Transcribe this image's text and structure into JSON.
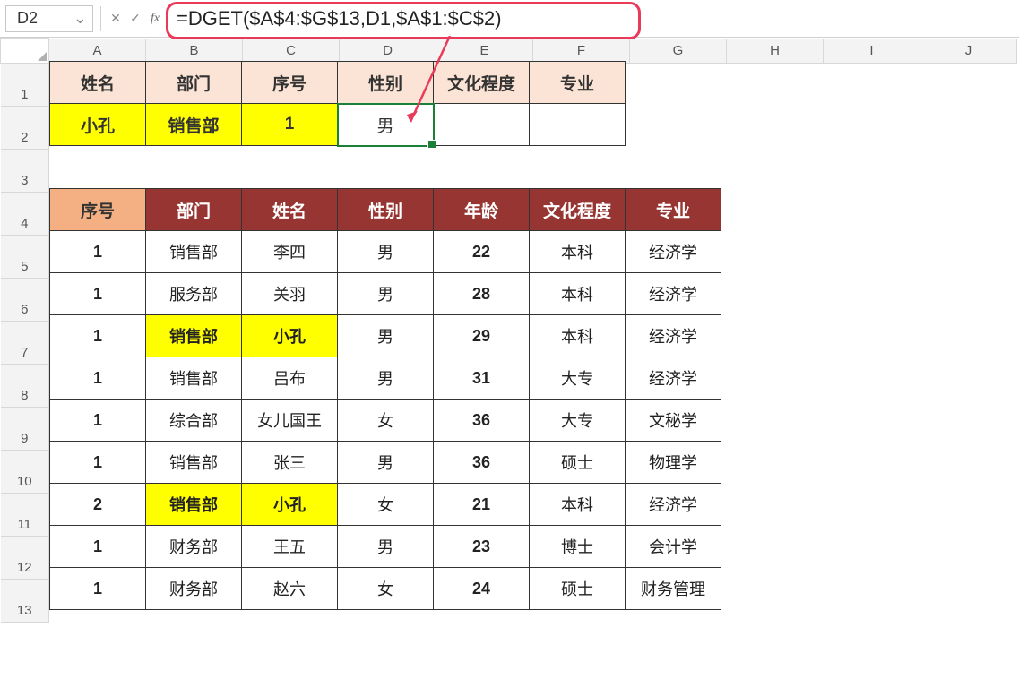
{
  "nameBox": {
    "value": "D2"
  },
  "formulaBar": {
    "text": "=DGET($A$4:$G$13,D1,$A$1:$C$2)"
  },
  "columns": [
    "A",
    "B",
    "C",
    "D",
    "E",
    "F",
    "G",
    "H",
    "I",
    "J"
  ],
  "rows": [
    "1",
    "2",
    "3",
    "4",
    "5",
    "6",
    "7",
    "8",
    "9",
    "10",
    "11",
    "12",
    "13"
  ],
  "lookup": {
    "headers": [
      "姓名",
      "部门",
      "序号",
      "性别",
      "文化程度",
      "专业"
    ],
    "row": [
      "小孔",
      "销售部",
      "1",
      "男",
      "",
      ""
    ]
  },
  "dataTable": {
    "headers": [
      "序号",
      "部门",
      "姓名",
      "性别",
      "年龄",
      "文化程度",
      "专业"
    ],
    "rows": [
      {
        "seq": "1",
        "dept": "销售部",
        "name": "李四",
        "sex": "男",
        "age": "22",
        "edu": "本科",
        "major": "经济学",
        "hl": false
      },
      {
        "seq": "1",
        "dept": "服务部",
        "name": "关羽",
        "sex": "男",
        "age": "28",
        "edu": "本科",
        "major": "经济学",
        "hl": false
      },
      {
        "seq": "1",
        "dept": "销售部",
        "name": "小孔",
        "sex": "男",
        "age": "29",
        "edu": "本科",
        "major": "经济学",
        "hl": true
      },
      {
        "seq": "1",
        "dept": "销售部",
        "name": "吕布",
        "sex": "男",
        "age": "31",
        "edu": "大专",
        "major": "经济学",
        "hl": false
      },
      {
        "seq": "1",
        "dept": "综合部",
        "name": "女儿国王",
        "sex": "女",
        "age": "36",
        "edu": "大专",
        "major": "文秘学",
        "hl": false
      },
      {
        "seq": "1",
        "dept": "销售部",
        "name": "张三",
        "sex": "男",
        "age": "36",
        "edu": "硕士",
        "major": "物理学",
        "hl": false
      },
      {
        "seq": "2",
        "dept": "销售部",
        "name": "小孔",
        "sex": "女",
        "age": "21",
        "edu": "本科",
        "major": "经济学",
        "hl": true
      },
      {
        "seq": "1",
        "dept": "财务部",
        "name": "王五",
        "sex": "男",
        "age": "23",
        "edu": "博士",
        "major": "会计学",
        "hl": false
      },
      {
        "seq": "1",
        "dept": "财务部",
        "name": "赵六",
        "sex": "女",
        "age": "24",
        "edu": "硕士",
        "major": "财务管理",
        "hl": false
      }
    ]
  },
  "icons": {
    "chevronDown": "⌄",
    "cancel": "✕",
    "accept": "✓"
  }
}
